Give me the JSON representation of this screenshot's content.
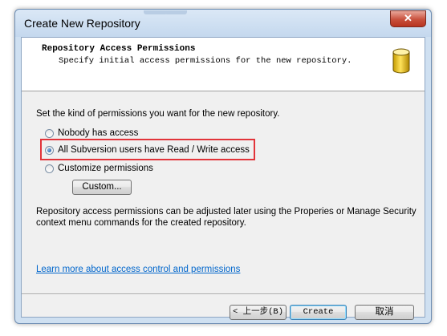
{
  "window": {
    "title": "Create New Repository",
    "close_label": "✕"
  },
  "header": {
    "title": "Repository Access Permissions",
    "subtitle": "Specify initial access permissions for the new repository."
  },
  "body": {
    "prompt": "Set the kind of permissions you want for the new repository.",
    "options": [
      {
        "label": "Nobody has access",
        "checked": false
      },
      {
        "label": "All Subversion users have Read / Write access",
        "checked": true
      },
      {
        "label": "Customize permissions",
        "checked": false
      }
    ],
    "custom_button": "Custom...",
    "note_line1": "Repository access permissions can be adjusted later using the Properies or Manage Security",
    "note_line2": "context menu commands for the created repository.",
    "learn_more": "Learn more about access control and permissions"
  },
  "footer": {
    "back_button": "< 上一步(B)",
    "create_button": "Create",
    "cancel_button": "取消"
  },
  "colors": {
    "highlight": "#e2343a",
    "link": "#0066cc",
    "title_bar": "#cfe0f1"
  }
}
